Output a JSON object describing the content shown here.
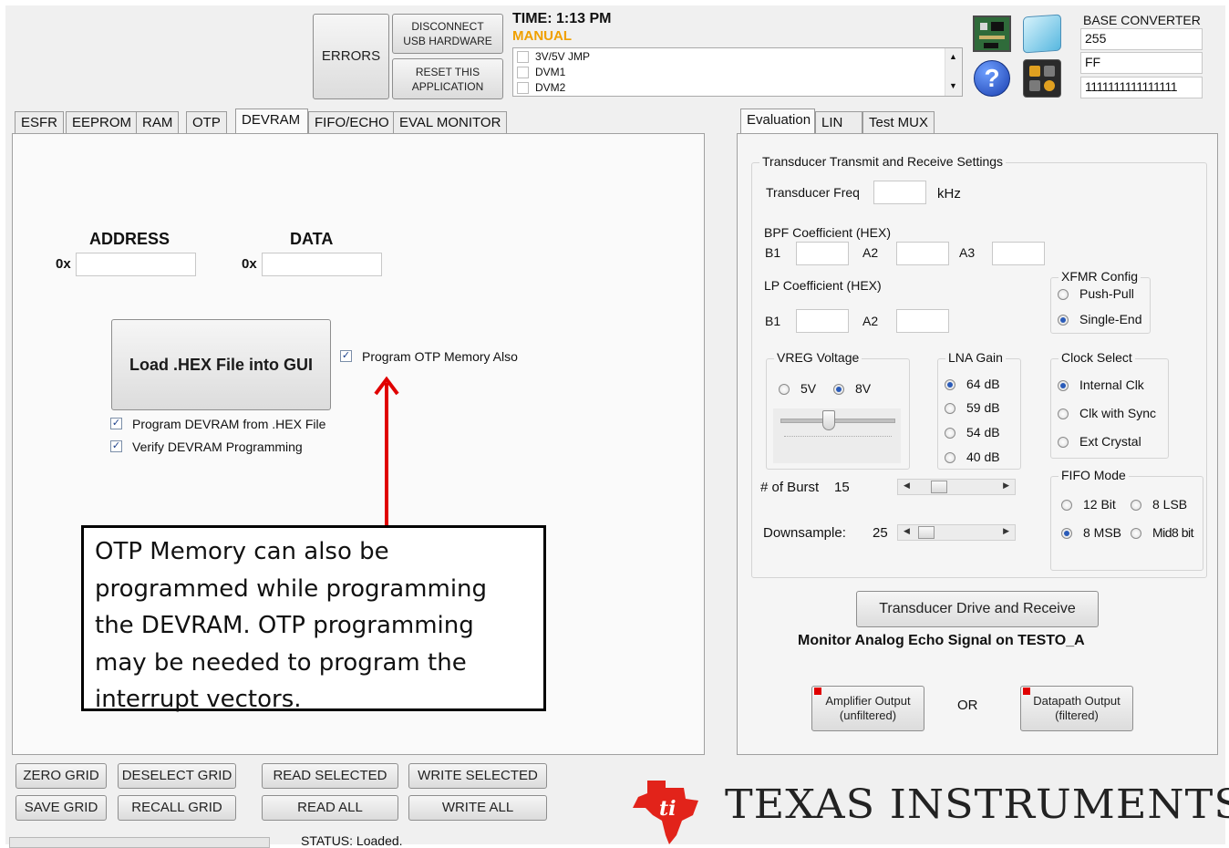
{
  "top": {
    "errors_label": "ERRORS",
    "disconnect_label": "DISCONNECT USB HARDWARE",
    "reset_label": "RESET THIS APPLICATION",
    "time_label": "TIME:  1:13 PM",
    "mode_label": "MANUAL",
    "mode_color": "#f0a000",
    "checklist": [
      "3V/5V JMP",
      "DVM1",
      "DVM2"
    ]
  },
  "base_converter": {
    "title": "BASE CONVERTER",
    "dec": "255",
    "hex": "FF",
    "bin": "1111111111111111"
  },
  "left_tabs": [
    "ESFR",
    "EEPROM",
    "RAM",
    "OTP",
    "DEVRAM",
    "FIFO/ECHO",
    "EVAL MONITOR"
  ],
  "left_active_tab": "DEVRAM",
  "devram": {
    "address_label": "ADDRESS",
    "data_label": "DATA",
    "prefix": "0x",
    "address_value": "",
    "data_value": "",
    "load_button": "Load .HEX File into GUI",
    "program_otp": "Program OTP Memory Also",
    "program_devram": "Program DEVRAM from .HEX File",
    "verify_devram": "Verify DEVRAM Programming",
    "callout": "OTP Memory can also be programmed while programming the DEVRAM.  OTP programming may be needed to program the interrupt vectors.",
    "arrow_color": "#e00000"
  },
  "right_tabs": [
    "Evaluation",
    "LIN",
    "Test MUX"
  ],
  "right_active_tab": "Evaluation",
  "eval": {
    "group_title": "Transducer Transmit and Receive Settings",
    "freq_label": "Transducer Freq",
    "freq_unit": "kHz",
    "bpf_label": "BPF Coefficient (HEX)",
    "b1": "B1",
    "a2": "A2",
    "a3": "A3",
    "lp_label": "LP Coefficient (HEX)",
    "xfmr_title": "XFMR Config",
    "xfmr_push": "Push-Pull",
    "xfmr_single": "Single-End",
    "vreg_title": "VREG Voltage",
    "vreg_5v": "5V",
    "vreg_8v": "8V",
    "lna_title": "LNA Gain",
    "lna_options": [
      "64 dB",
      "59 dB",
      "54 dB",
      "40 dB"
    ],
    "clock_title": "Clock Select",
    "clock_options": [
      "Internal Clk",
      "Clk with Sync",
      "Ext Crystal"
    ],
    "burst_label": "# of Burst",
    "burst_value": "15",
    "downsample_label": "Downsample:",
    "downsample_value": "25",
    "fifo_title": "FIFO Mode",
    "fifo_12bit": "12 Bit",
    "fifo_8lsb": "8 LSB",
    "fifo_8msb": "8 MSB",
    "fifo_mid8": "Mid8 bit",
    "drive_button": "Transducer Drive and Receive",
    "monitor_text": "Monitor Analog Echo Signal  on TESTO_A",
    "amp_button": "Amplifier Output (unfiltered)",
    "or_label": "OR",
    "datapath_button": "Datapath Output (filtered)"
  },
  "bottom": {
    "zero_grid": "ZERO GRID",
    "deselect_grid": "DESELECT GRID",
    "read_selected": "READ SELECTED",
    "write_selected": "WRITE SELECTED",
    "save_grid": "SAVE GRID",
    "recall_grid": "RECALL GRID",
    "read_all": "READ ALL",
    "write_all": "WRITE ALL",
    "status": "STATUS: Loaded."
  },
  "brand": {
    "name": "TEXAS INSTRUMENTS",
    "logo_color": "#e2231a"
  },
  "icons": [
    "board-icon",
    "window-icon",
    "help-icon",
    "gear-app-icon"
  ]
}
